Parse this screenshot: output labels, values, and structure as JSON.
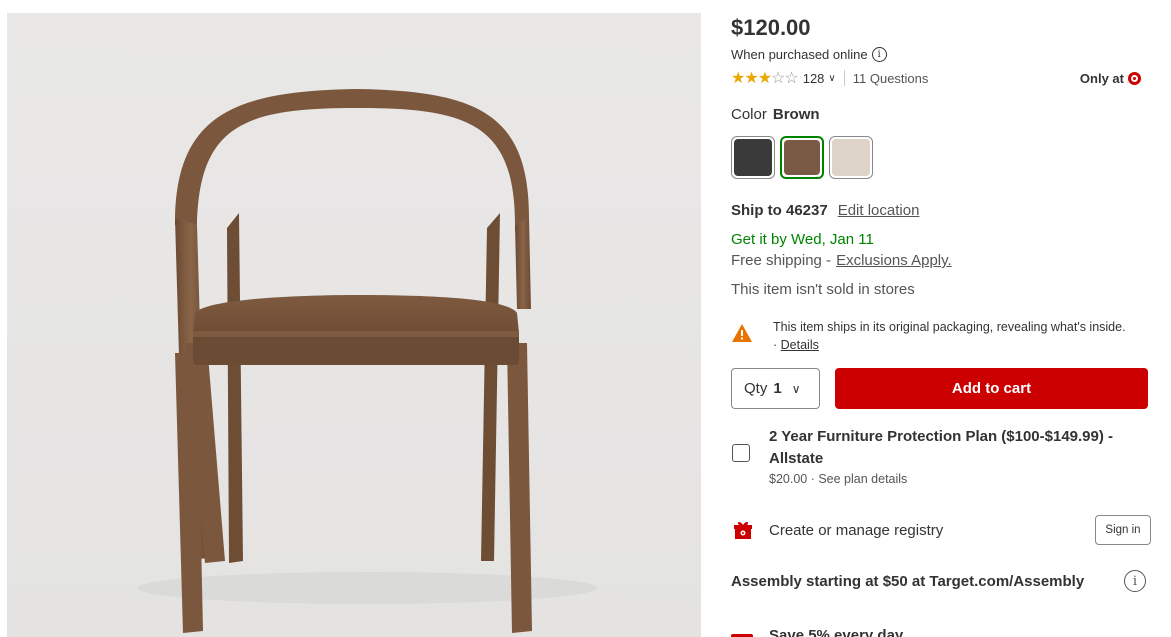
{
  "product": {
    "price": "$120.00",
    "price_note": "When purchased online",
    "rating": {
      "stars_value": 3,
      "stars_max": 5,
      "review_count": "128",
      "questions": "11 Questions"
    },
    "only_at": "Only at",
    "color": {
      "label": "Color",
      "selected": "Brown",
      "swatches": [
        {
          "name": "black",
          "hex": "#3a3a3a"
        },
        {
          "name": "brown",
          "hex": "#7b5a45"
        },
        {
          "name": "cream",
          "hex": "#ddd3c6"
        }
      ]
    },
    "shipping": {
      "ship_to": "Ship to 46237",
      "edit_location": "Edit location",
      "get_it": "Get it by Wed, Jan 11",
      "free_shipping": "Free shipping -",
      "exclusions": "Exclusions Apply.",
      "not_sold": "This item isn't sold in stores"
    },
    "warning": {
      "text": "This item ships in its original packaging, revealing what's inside.",
      "separator": "·",
      "details": "Details"
    },
    "qty": {
      "label": "Qty",
      "value": "1"
    },
    "add_to_cart": "Add to cart",
    "protection_plan": {
      "title": "2 Year Furniture Protection Plan ($100-$149.99) - Allstate",
      "price": "$20.00",
      "details": "See plan details"
    },
    "registry": {
      "label": "Create or manage registry",
      "sign_in": "Sign in"
    },
    "assembly": "Assembly starting at $50 at Target.com/Assembly",
    "save": "Save 5% every day"
  },
  "colors": {
    "accent_red": "#cc0000",
    "success_green": "#008300",
    "star_gold": "#e8a800"
  }
}
